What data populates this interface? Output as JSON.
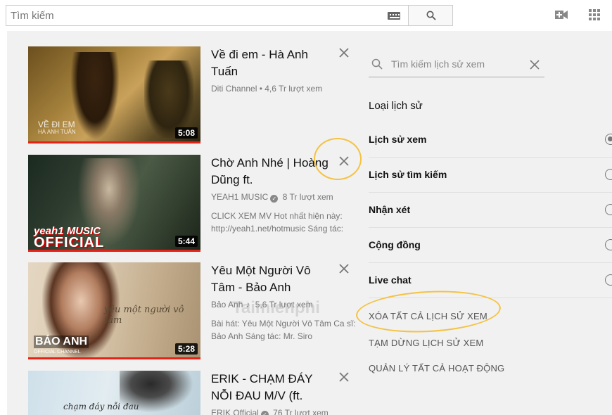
{
  "header": {
    "search_placeholder": "Tìm kiếm"
  },
  "videos": [
    {
      "title": "Về đi em - Hà Anh Tuấn",
      "channel": "Diti Channel",
      "views": "• 4,6 Tr lượt xem",
      "description": "",
      "duration": "5:08",
      "thumb_text_1": "VỀ ĐI EM",
      "thumb_text_2": "HÀ ANH TUẤN"
    },
    {
      "title": "Chờ Anh Nhé | Hoàng Dũng ft.",
      "channel": "YEAH1 MUSIC",
      "views": "8 Tr lượt xem",
      "description": "CLICK XEM MV Hot nhất hiện này: http://yeah1.net/hotmusic Sáng tác:",
      "duration": "5:44",
      "thumb_text_1": "yeah1 MUSIC",
      "thumb_text_2": "OFFICIAL"
    },
    {
      "title": "Yêu Một Người Vô Tâm - Bảo Anh",
      "channel": "Bảo Anh",
      "views": "5,6 Tr lượt xem",
      "description": "Bài hát: Yêu Một Người Vô Tâm Ca sĩ: Bảo Anh Sáng tác: Mr. Siro",
      "duration": "5:28",
      "thumb_text_1": "yêu một người vô tâm",
      "thumb_text_2": "BẢO ANH",
      "thumb_text_3": "OFFICIAL CHANNEL"
    },
    {
      "title": "ERIK - CHẠM ĐÁY NỖI ĐAU M/V (ft.",
      "channel": "ERIK Official",
      "views": "76 Tr lượt xem",
      "description": "",
      "duration": "",
      "thumb_text_1": "chạm đáy nỗi đau"
    }
  ],
  "panel": {
    "search_placeholder": "Tìm kiếm lịch sử xem",
    "history_type_heading": "Loại lịch sử",
    "options": [
      {
        "label": "Lịch sử xem",
        "selected": true
      },
      {
        "label": "Lịch sử tìm kiếm",
        "selected": false
      },
      {
        "label": "Nhận xét",
        "selected": false
      },
      {
        "label": "Cộng đồng",
        "selected": false
      },
      {
        "label": "Live chat",
        "selected": false
      }
    ],
    "actions": {
      "clear_all": "XÓA TẤT CẢ LỊCH SỬ XEM",
      "pause": "TẠM DỪNG LỊCH SỬ XEM",
      "manage": "QUẢN LÝ TẤT CẢ HOẠT ĐỘNG"
    }
  },
  "watermark": "Taimienphi",
  "colors": {
    "accent_red": "#e62117",
    "annotation": "#f5c242",
    "background": "#f1f1f1"
  }
}
